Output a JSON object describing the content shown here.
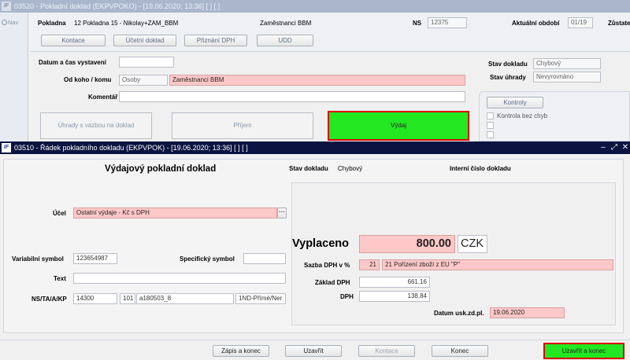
{
  "bg_window": {
    "title": "03520 - Pokladní doklad (EKPVPOKO) - [19.06.2020; 13:36]  [ ]  [ ]",
    "nav_label": "Nav",
    "pokladna_label": "Pokladna",
    "pokladna_value": "12 Pokladna 15 - Nikolay+ZAM_BBM",
    "pokladna_name": "Zaměstnanci BBM",
    "ns_label": "NS",
    "ns_value": "12375",
    "period_label": "Aktuální období",
    "period_value": "01/19",
    "zustatek_label": "Zůstate",
    "tabs": [
      "Kontace",
      "Účetní doklad",
      "Přiznání DPH",
      "UDD"
    ],
    "datum_label": "Datum a čas vystavení",
    "datum_value": "",
    "od_koho_label": "Od koho / komu",
    "od_koho_type": "Osoby",
    "od_koho_value": "Zaměstnanci BBM",
    "komentar_label": "Komentář",
    "komentar_value": "",
    "stav_dokladu_label": "Stav dokladu",
    "stav_dokladu_value": "Chybový",
    "stav_uhrady_label": "Stav úhrady",
    "stav_uhrady_value": "Nevyrovnáno",
    "kontroly_button": "Kontroly",
    "kontrola_item": "Kontrola bez chyb",
    "uhrady_button": "Úhrady s vazbou na doklad",
    "prijem_button": "Příjem",
    "vydej_button": "Výdaj"
  },
  "front_window": {
    "title": "03510 - Řádek pokladního dokladu (EKPVPOK) - [19.06.2020; 13:36]  [ ]  [ ]",
    "heading": "Výdajový pokladní doklad",
    "stav_dokladu_label": "Stav dokladu",
    "stav_dokladu_value": "Chybový",
    "interni_cislo_label": "Interní číslo dokladu",
    "ucel_label": "Účel",
    "ucel_value": "Ostatní výdaje - Kč s DPH",
    "variabilni_label": "Variabilní symbol",
    "variabilni_value": "123654987",
    "specificky_label": "Specifický symbol",
    "specificky_value": "",
    "text_label": "Text",
    "text_value": "",
    "ns_label": "NS/TA/A/KP",
    "ns_value": "14300",
    "ta_value": "101",
    "a_value": "a180503_8",
    "kp_value": "1ND-Přímé/Ner",
    "vyplaceno_label": "Vyplaceno",
    "vyplaceno_value": "800.00",
    "currency": "CZK",
    "sazba_label": "Sazba DPH v %",
    "sazba_value": "21",
    "sazba_desc": "21  Pořízení zboží z EU \"P\"",
    "zaklad_label": "Základ DPH",
    "zaklad_value": "661.16",
    "dph_label": "DPH",
    "dph_value": "138.84",
    "datum_label": "Datum usk.zd.pl.",
    "datum_value": "19.06.2020",
    "buttons": {
      "zapis": "Zápis a konec",
      "uzavrit": "Uzavřít",
      "kontace": "Kontace",
      "konec": "Konec",
      "uzavrit_konec": "Uzavřít a konec"
    }
  },
  "colors": {
    "active_title": "#0b1440",
    "inactive_title": "#a9b6cc",
    "required_field": "#ffc8c8",
    "green_button": "#22e822",
    "highlight_border": "#dd0000"
  }
}
